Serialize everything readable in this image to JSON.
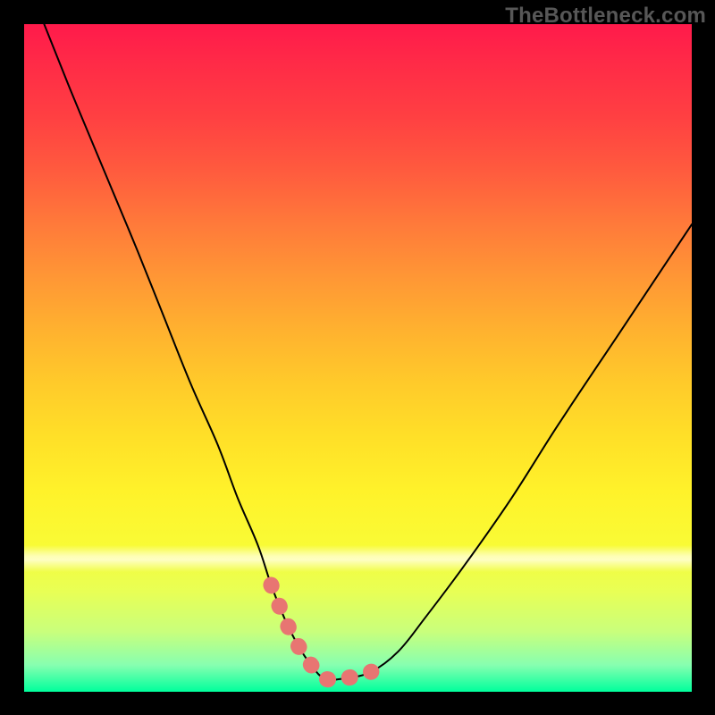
{
  "watermark": {
    "text": "TheBottleneck.com"
  },
  "chart_data": {
    "type": "line",
    "title": "",
    "xlabel": "",
    "ylabel": "",
    "ylim": [
      0,
      100
    ],
    "xlim": [
      0,
      100
    ],
    "series": [
      {
        "name": "bottleneck-curve",
        "x": [
          3,
          7,
          12,
          17,
          21,
          25,
          29,
          32,
          35,
          37,
          39,
          41,
          43,
          45,
          48,
          52,
          56,
          60,
          66,
          73,
          80,
          88,
          96,
          100
        ],
        "values": [
          100,
          90,
          78,
          66,
          56,
          46,
          37,
          29,
          22,
          16,
          11,
          7,
          4,
          2,
          2,
          3,
          6,
          11,
          19,
          29,
          40,
          52,
          64,
          70
        ]
      }
    ],
    "marker_segment": {
      "name": "optimal-range",
      "x": [
        37,
        39,
        41,
        43,
        45,
        48,
        52
      ],
      "values": [
        16,
        11,
        7,
        4,
        2,
        2,
        3
      ]
    },
    "gradient_stops": [
      {
        "pos": 0,
        "color": "#ff1a4b"
      },
      {
        "pos": 30,
        "color": "#ff7a3a"
      },
      {
        "pos": 62,
        "color": "#ffe028"
      },
      {
        "pos": 85,
        "color": "#e8ff55"
      },
      {
        "pos": 100,
        "color": "#00ff9c"
      }
    ]
  }
}
